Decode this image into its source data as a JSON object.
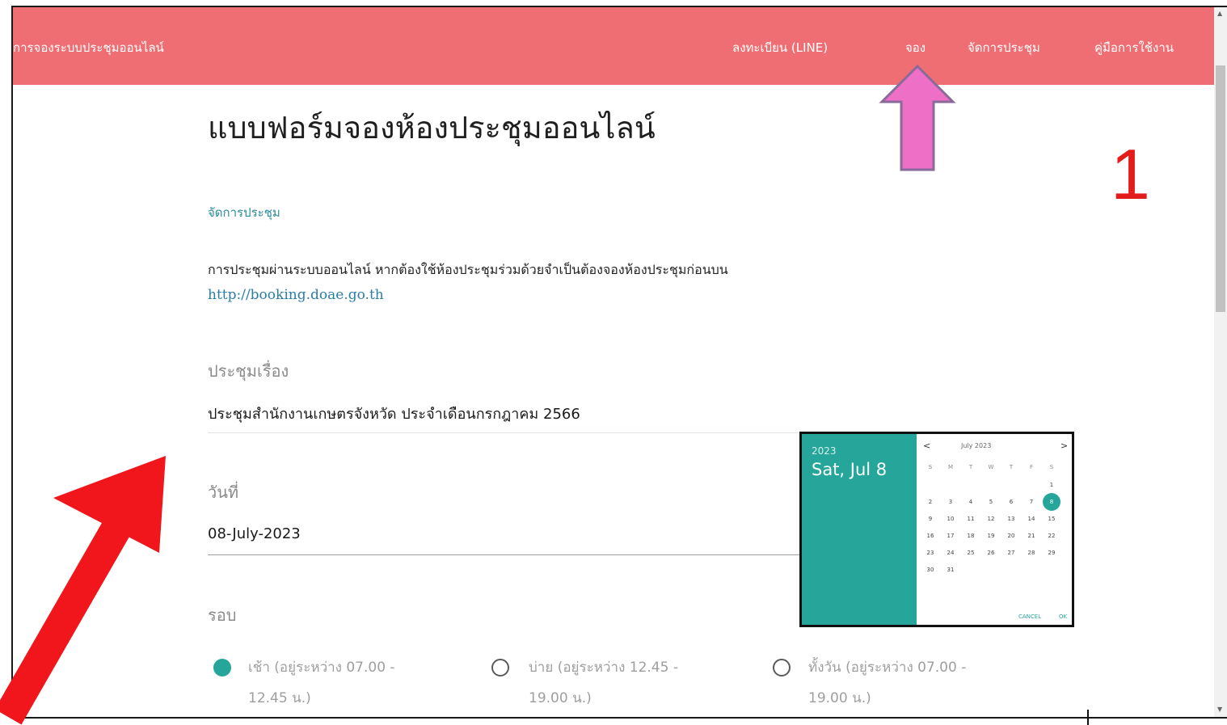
{
  "navbar": {
    "brand": "การจองระบบประชุมออนไลน์",
    "items": [
      {
        "label": "ลงทะเบียน (LINE)"
      },
      {
        "label": "จอง"
      },
      {
        "label": "จัดการประชุม"
      },
      {
        "label": "คู่มือการใช้งาน"
      }
    ]
  },
  "page": {
    "title": "แบบฟอร์มจองห้องประชุมออนไลน์",
    "manage_link": "จัดการประชุม",
    "description": "การประชุมผ่านระบบออนไลน์ หากต้องใช้ห้องประชุมร่วมด้วยจำเป็นต้องจองห้องประชุมก่อนบน",
    "booking_url": "http://booking.doae.go.th"
  },
  "form": {
    "subject_label": "ประชุมเรื่อง",
    "subject_value": "ประชุมสำนักงานเกษตรจังหวัด ประจำเดือนกรกฎาคม 2566",
    "date_label": "วันที่",
    "date_value": "08-July-2023",
    "round_label": "รอบ",
    "rounds": [
      {
        "line1": "เช้า (อยู่ระหว่าง 07.00 -",
        "line2": "12.45 น.)",
        "selected": true
      },
      {
        "line1": "บ่าย (อยู่ระหว่าง 12.45 -",
        "line2": "19.00 น.)",
        "selected": false
      },
      {
        "line1": "ทั้งวัน (อยู่ระหว่าง 07.00 -",
        "line2": "19.00 น.)",
        "selected": false
      }
    ]
  },
  "datepicker": {
    "year": "2023",
    "date_display": "Sat, Jul 8",
    "month_label": "July 2023",
    "prev": "<",
    "next": ">",
    "weekdays": [
      "S",
      "M",
      "T",
      "W",
      "T",
      "F",
      "S"
    ],
    "first_weekday_index": 6,
    "days_in_month": 31,
    "selected_day": 8,
    "cancel": "CANCEL",
    "ok": "OK"
  },
  "annotations": {
    "step_number": "1",
    "arrow_color_pink": "#ee6fc6",
    "arrow_color_red": "#f0161b"
  },
  "colors": {
    "navbar": "#ee6e73",
    "teal": "#26a69a",
    "link": "#2a7ea7"
  }
}
